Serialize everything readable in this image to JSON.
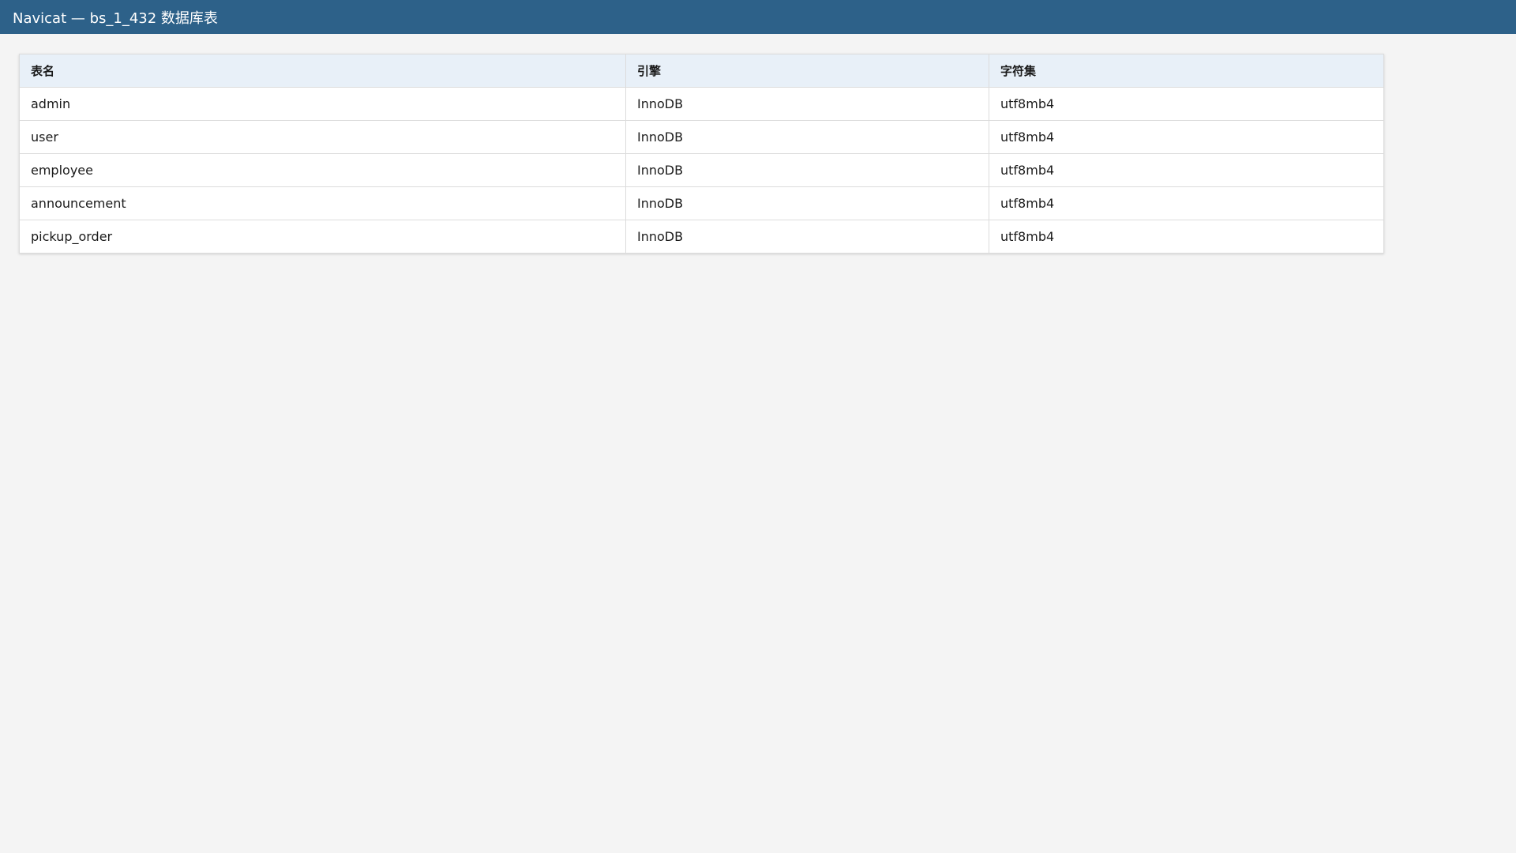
{
  "window": {
    "title": "Navicat — bs_1_432 数据库表"
  },
  "table": {
    "headers": {
      "name": "表名",
      "engine": "引擎",
      "charset": "字符集"
    },
    "rows": [
      {
        "name": "admin",
        "engine": "InnoDB",
        "charset": "utf8mb4"
      },
      {
        "name": "user",
        "engine": "InnoDB",
        "charset": "utf8mb4"
      },
      {
        "name": "employee",
        "engine": "InnoDB",
        "charset": "utf8mb4"
      },
      {
        "name": "announcement",
        "engine": "InnoDB",
        "charset": "utf8mb4"
      },
      {
        "name": "pickup_order",
        "engine": "InnoDB",
        "charset": "utf8mb4"
      }
    ]
  },
  "colors": {
    "titlebar": "#2d6189",
    "header_bg": "#e8f0f8",
    "page_bg": "#f4f4f4"
  }
}
